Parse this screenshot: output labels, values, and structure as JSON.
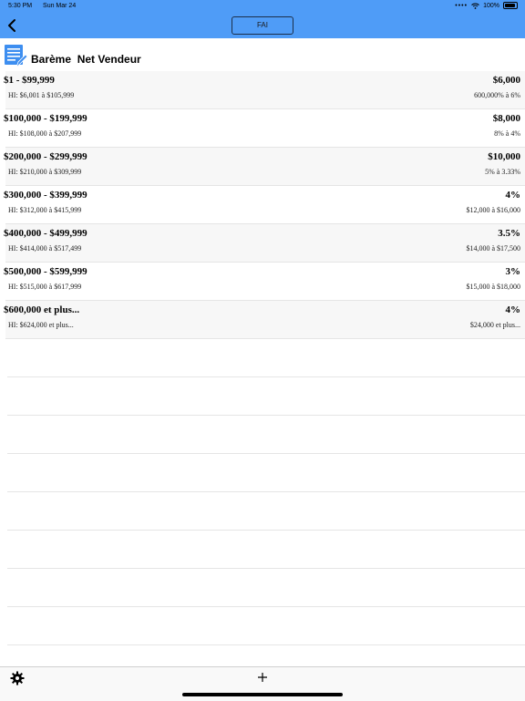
{
  "status_bar": {
    "time": "5:30 PM",
    "date": "Sun Mar 24",
    "battery": "100%"
  },
  "nav": {
    "fai_label": "FAI"
  },
  "header": {
    "title": "Barème  Net Vendeur"
  },
  "rows": [
    {
      "range": "$1 - $99,999",
      "fee": "$6,000",
      "hi": "HI: $6,001 à $105,999",
      "percent": "600,000% à 6%"
    },
    {
      "range": "$100,000 - $199,999",
      "fee": "$8,000",
      "hi": "HI: $108,000 à $207,999",
      "percent": "8% à 4%"
    },
    {
      "range": "$200,000 - $299,999",
      "fee": "$10,000",
      "hi": "HI: $210,000 à $309,999",
      "percent": "5% à 3.33%"
    },
    {
      "range": "$300,000 - $399,999",
      "fee": "4%",
      "hi": "HI: $312,000 à $415,999",
      "percent": "$12,000 à $16,000"
    },
    {
      "range": "$400,000 - $499,999",
      "fee": "3.5%",
      "hi": "HI: $414,000 à $517,499",
      "percent": "$14,000 à $17,500"
    },
    {
      "range": "$500,000 - $599,999",
      "fee": "3%",
      "hi": "HI: $515,000 à $617,999",
      "percent": "$15,000 à $18,000"
    },
    {
      "range": "$600,000 et plus...",
      "fee": "4%",
      "hi": "HI: $624,000 et plus...",
      "percent": "$24,000 et plus..."
    }
  ],
  "icons": {
    "back": "chevron-left-icon",
    "document": "document-edit-icon",
    "settings": "gear-icon",
    "add": "plus-icon"
  },
  "colors": {
    "nav_background": "#4f9cf7",
    "icon_blue": "#3d8ef0"
  }
}
